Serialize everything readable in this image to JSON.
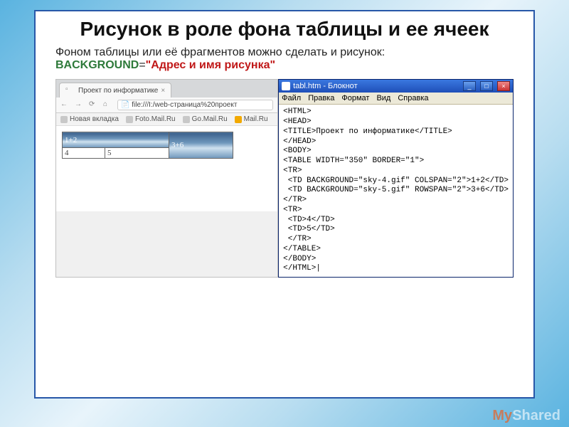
{
  "slide": {
    "title": "Рисунок в роле фона таблицы и ее ячеек",
    "desc_prefix": "Фоном таблицы или её фрагментов можно сделать и рисунок:",
    "kw1": "BACKGROUND",
    "eq": "=",
    "kw2": "\"Адрес и имя рисунка\""
  },
  "browser": {
    "tab_title": "Проект по информатике",
    "tab_close": "×",
    "nav": {
      "back": "←",
      "fwd": "→",
      "reload": "⟳",
      "home": "⌂"
    },
    "url_prefix": "📄",
    "url": "file:///I:/web-страница%20проект",
    "bookmarks": [
      "Новая вкладка",
      "Foto.Mail.Ru",
      "Go.Mail.Ru",
      "Mail.Ru"
    ],
    "example": {
      "cell_a": "1+2",
      "cell_b": "3+6",
      "cell_c": "4",
      "cell_d": "5"
    }
  },
  "notepad": {
    "title": "tabl.htm - Блокнот",
    "win": {
      "min": "_",
      "max": "□",
      "close": "×"
    },
    "menu": [
      "Файл",
      "Правка",
      "Формат",
      "Вид",
      "Справка"
    ],
    "code": "<HTML>\n<HEAD>\n<TITLE>Проект по информатике</TITLE>\n</HEAD>\n<BODY>\n<TABLE WIDTH=\"350\" BORDER=\"1\">\n<TR>\n <TD BACKGROUND=\"sky-4.gif\" COLSPAN=\"2\">1+2</TD>\n <TD BACKGROUND=\"sky-5.gif\" ROWSPAN=\"2\">3+6</TD>\n</TR>\n<TR>\n <TD>4</TD>\n <TD>5</TD>\n </TR>\n</TABLE>\n</BODY>\n</HTML>|"
  },
  "watermark": {
    "my": "My",
    "shared": "Shared"
  }
}
